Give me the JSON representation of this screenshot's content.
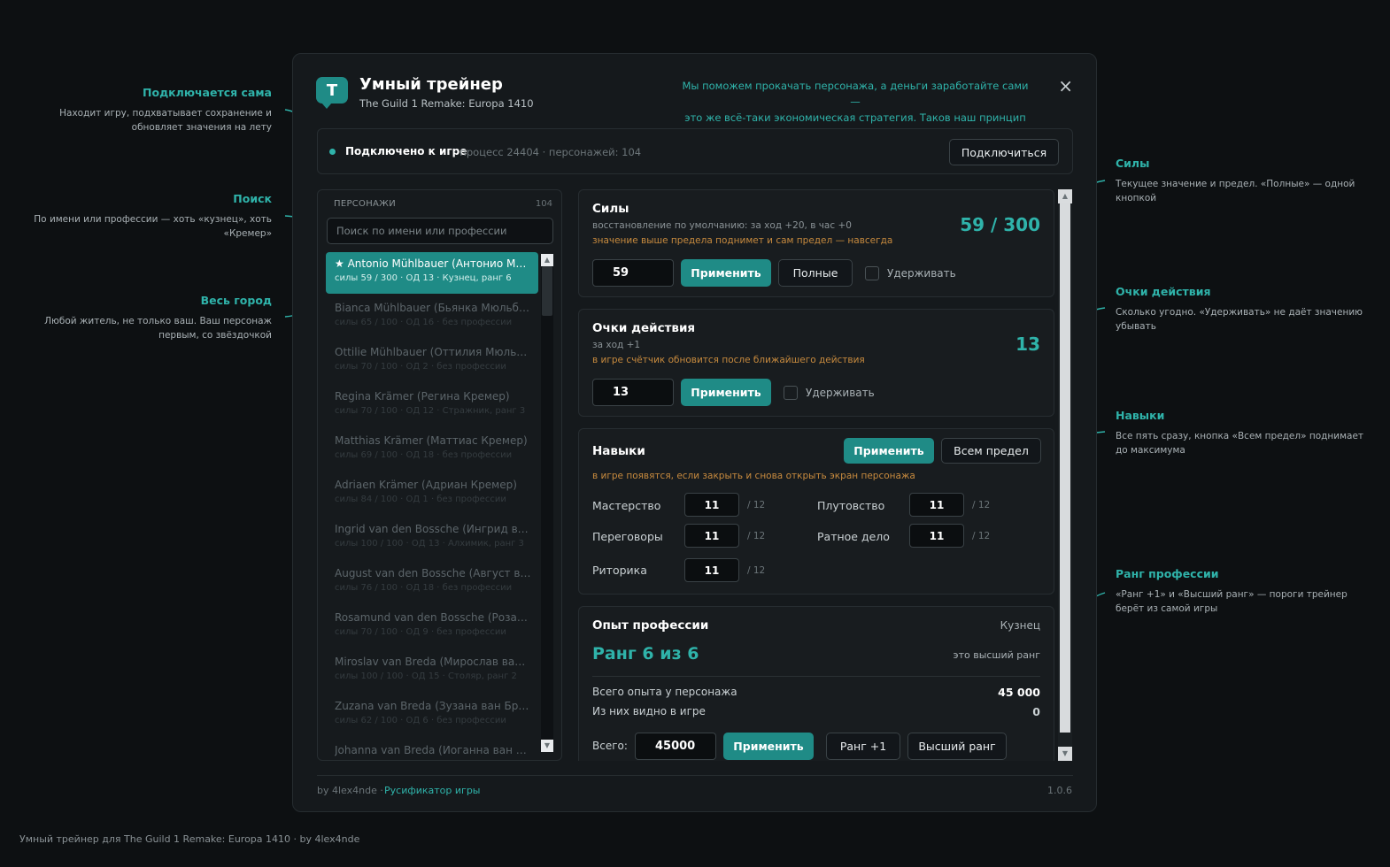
{
  "annotations": {
    "left": [
      {
        "title": "Подключается сама",
        "desc": "Находит игру, подхватывает сохранение и обновляет значения на лету"
      },
      {
        "title": "Поиск",
        "desc": "По имени или профессии — хоть «кузнец», хоть «Кремер»"
      },
      {
        "title": "Весь город",
        "desc": "Любой житель, не только ваш. Ваш персонаж первым, со звёздочкой"
      }
    ],
    "right": [
      {
        "title": "Силы",
        "desc": "Текущее значение и предел. «Полные» — одной кнопкой"
      },
      {
        "title": "Очки действия",
        "desc": "Сколько угодно. «Удерживать» не даёт значению убывать"
      },
      {
        "title": "Навыки",
        "desc": "Все пять сразу, кнопка «Всем предел» поднимает до максимума"
      },
      {
        "title": "Ранг профессии",
        "desc": "«Ранг +1» и «Высший ранг» — пороги трейнер берёт из самой игры"
      }
    ]
  },
  "footer_note": "Умный трейнер для The Guild 1 Remake: Europa 1410 · by 4lex4nde",
  "app": {
    "logo_letter": "T",
    "title": "Умный трейнер",
    "subtitle": "The Guild 1 Remake: Europa 1410",
    "slogan_line1": "Мы поможем прокачать персонажа, а деньги заработайте сами —",
    "slogan_line2": "это же всё-таки экономическая стратегия. Таков наш принцип ☺",
    "close_icon": "×"
  },
  "status": {
    "connected": "Подключено к игре",
    "meta": "· процесс 24404 · персонажей: 104",
    "connect_button": "Подключиться"
  },
  "characters": {
    "header": "ПЕРСОНАЖИ",
    "count": "104",
    "search_placeholder": "Поиск по имени или профессии",
    "items": [
      {
        "name": "★ Antonio Mühlbauer (Антонио Мю…",
        "meta": "силы 59 / 300 · ОД 13 · Кузнец, ранг 6"
      },
      {
        "name": "Bianca Mühlbauer (Бьянка Мюльба…",
        "meta": "силы 65 / 100 · ОД 16 · без профессии"
      },
      {
        "name": "Ottilie Mühlbauer (Оттилия Мюльб…",
        "meta": "силы 70 / 100 · ОД 2 · без профессии"
      },
      {
        "name": "Regina Krämer (Регина Кремер)",
        "meta": "силы 70 / 100 · ОД 12 · Стражник, ранг 3"
      },
      {
        "name": "Matthias Krämer (Маттиас Кремер)",
        "meta": "силы 69 / 100 · ОД 18 · без профессии"
      },
      {
        "name": "Adriaen Krämer (Адриан Кремер)",
        "meta": "силы 84 / 100 · ОД 1 · без профессии"
      },
      {
        "name": "Ingrid van den Bossche (Ингрид ва…",
        "meta": "силы 100 / 100 · ОД 13 · Алхимик, ранг 3"
      },
      {
        "name": "August van den Bossche (Август ва…",
        "meta": "силы 76 / 100 · ОД 18 · без профессии"
      },
      {
        "name": "Rosamund van den Bossche (Розам…",
        "meta": "силы 70 / 100 · ОД 9 · без профессии"
      },
      {
        "name": "Miroslav van Breda (Мирослав ван…",
        "meta": "силы 100 / 100 · ОД 15 · Столяр, ранг 2"
      },
      {
        "name": "Zuzana van Breda (Зузана ван Бре…",
        "meta": "силы 62 / 100 · ОД 6 · без профессии"
      },
      {
        "name": "Johanna van Breda (Иоганна ван Б…",
        "meta": ""
      }
    ]
  },
  "strength": {
    "title": "Силы",
    "hint": "восстановление по умолчанию: за ход +20, в час +0",
    "warn": "значение выше предела поднимет и сам предел — навсегда",
    "value_display": "59 / 300",
    "input_value": "59",
    "apply": "Применить",
    "full": "Полные",
    "hold": "Удерживать"
  },
  "action_points": {
    "title": "Очки действия",
    "hint": "за ход +1",
    "warn": "в игре счётчик обновится после ближайшего действия",
    "value_display": "13",
    "input_value": "13",
    "apply": "Применить",
    "hold": "Удерживать"
  },
  "skills": {
    "title": "Навыки",
    "apply": "Применить",
    "max_all": "Всем предел",
    "warn": "в игре появятся, если закрыть и снова открыть экран персонажа",
    "items": [
      {
        "label": "Мастерство",
        "value": "11",
        "max": "/ 12"
      },
      {
        "label": "Плутовство",
        "value": "11",
        "max": "/ 12"
      },
      {
        "label": "Переговоры",
        "value": "11",
        "max": "/ 12"
      },
      {
        "label": "Ратное дело",
        "value": "11",
        "max": "/ 12"
      },
      {
        "label": "Риторика",
        "value": "11",
        "max": "/ 12"
      }
    ]
  },
  "profession": {
    "title": "Опыт профессии",
    "profession_name": "Кузнец",
    "rank": "Ранг 6 из 6",
    "rank_note": "это высший ранг",
    "total_label": "Всего опыта у персонажа",
    "total_value": "45 000",
    "visible_label": "Из них видно в игре",
    "visible_value": "0",
    "input_label": "Всего:",
    "input_value": "45000",
    "apply": "Применить",
    "rank_up": "Ранг +1",
    "max_rank": "Высший ранг"
  },
  "footer": {
    "by": "by 4lex4nde  ·",
    "link": "Русификатор игры",
    "version": "1.0.6"
  },
  "colors": {
    "accent": "#1f8b86",
    "accent_text": "#2fb3aa",
    "warning": "#c78a3e",
    "background": "#0d1012"
  }
}
